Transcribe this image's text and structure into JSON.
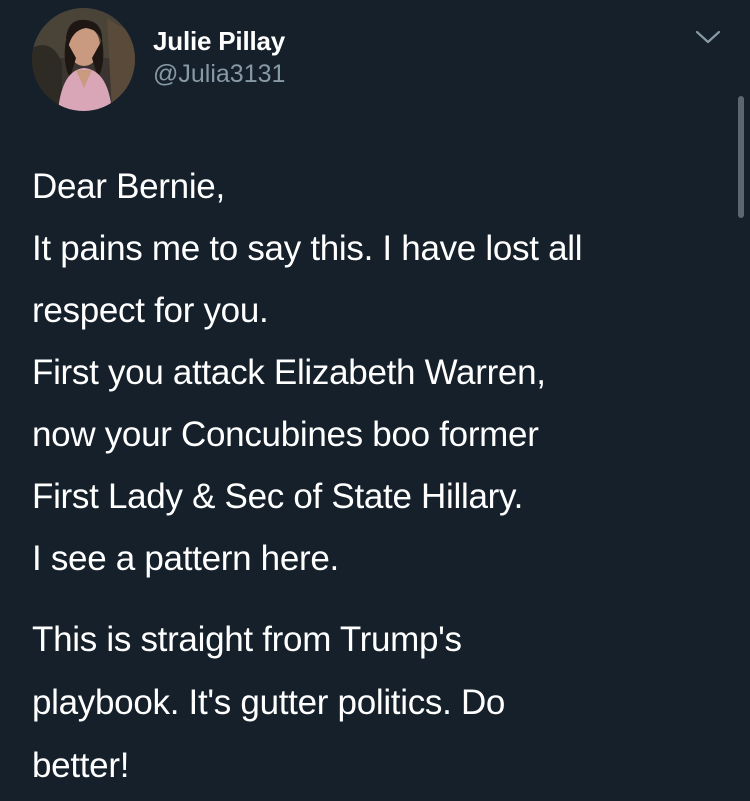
{
  "author": {
    "display_name": "Julie Pillay",
    "handle": "@Julia3131",
    "avatar_icon": "profile-photo"
  },
  "menu": {
    "icon": "chevron-down-icon"
  },
  "tweet": {
    "paragraph1": [
      "Dear Bernie,",
      "It pains me to say this. I have lost all",
      "respect for you.",
      "First you attack Elizabeth Warren,",
      "now your Concubines boo former",
      "First Lady & Sec of State Hillary.",
      "I see a pattern here."
    ],
    "paragraph2": [
      "This is straight from Trump's",
      "playbook. It's gutter politics. Do",
      "better!"
    ]
  },
  "colors": {
    "background": "#15202b",
    "text": "#ffffff",
    "secondary_text": "#8899a6"
  }
}
